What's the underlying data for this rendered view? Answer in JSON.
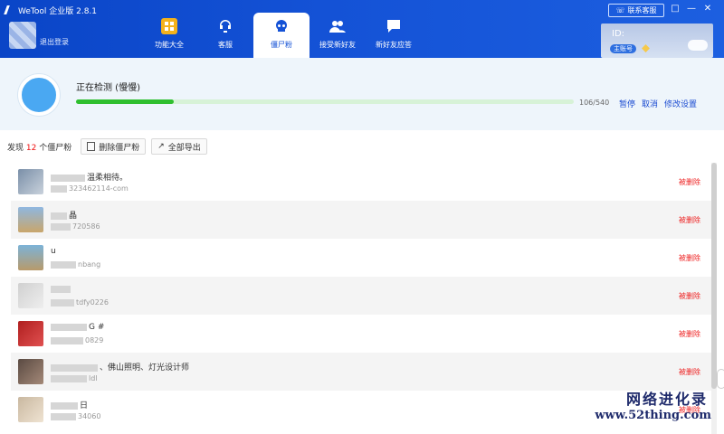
{
  "window": {
    "title": "WeTool 企业版 2.8.1",
    "contact_label": "联系客服",
    "controls": [
      "□",
      "—",
      "✕"
    ]
  },
  "account": {
    "logout_label": "退出登录",
    "id_label": "ID:",
    "badge": "主账号"
  },
  "nav": [
    {
      "label": "功能大全",
      "icon": "grid-icon",
      "active": false
    },
    {
      "label": "客服",
      "icon": "headset-icon",
      "active": false
    },
    {
      "label": "僵尸粉",
      "icon": "skull-icon",
      "active": true
    },
    {
      "label": "接受新好友",
      "icon": "users-icon",
      "active": false
    },
    {
      "label": "新好友应答",
      "icon": "chat-icon",
      "active": false
    }
  ],
  "scan": {
    "title": "正在检测 (慢慢)",
    "checked": 106,
    "total": 540,
    "count_label": "106/540",
    "actions": [
      "暂停",
      "取消",
      "修改设置"
    ]
  },
  "toolbar": {
    "found_prefix": "发现",
    "found_count": "12",
    "found_suffix": "个僵尸粉",
    "delete_label": "删除僵尸粉",
    "export_label": "全部导出"
  },
  "contacts": [
    {
      "name": "温柔相待。",
      "sub": "323462114-com",
      "status": "被删除"
    },
    {
      "name": "晶",
      "sub": "720586",
      "status": "被删除"
    },
    {
      "name": "u",
      "sub": "nbang",
      "status": "被删除"
    },
    {
      "name": "",
      "sub": "tdfy0226",
      "status": "被删除"
    },
    {
      "name": "G #",
      "sub": "0829",
      "status": "被删除"
    },
    {
      "name": "、佛山照明、灯光设计师",
      "sub": "ldl",
      "status": "被删除"
    },
    {
      "name": "日",
      "sub": "34060",
      "status": "被删除"
    }
  ],
  "watermark": {
    "line1": "网络进化录",
    "line2": "www.52thing.com"
  }
}
